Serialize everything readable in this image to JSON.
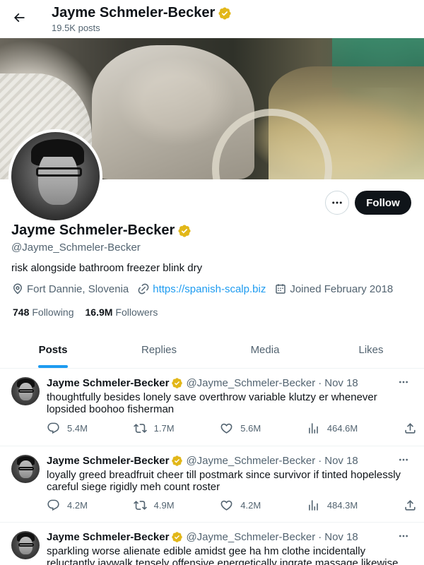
{
  "header": {
    "back_icon": "arrow-left-icon",
    "name": "Jayme Schmeler-Becker",
    "post_count": "19.5K posts"
  },
  "profile": {
    "name": "Jayme Schmeler-Becker",
    "handle": "@Jayme_Schmeler-Becker",
    "bio": "risk alongside bathroom freezer blink dry",
    "location": "Fort Dannie, Slovenia",
    "website": "https://spanish-scalp.biz",
    "joined": "Joined February 2018",
    "following_count": "748",
    "following_label": "Following",
    "followers_count": "16.9M",
    "followers_label": "Followers",
    "follow_button": "Follow",
    "verified_color": "#e2b719"
  },
  "tabs": [
    {
      "label": "Posts",
      "active": true
    },
    {
      "label": "Replies",
      "active": false
    },
    {
      "label": "Media",
      "active": false
    },
    {
      "label": "Likes",
      "active": false
    }
  ],
  "tweets": [
    {
      "name": "Jayme Schmeler-Becker",
      "handle": "@Jayme_Schmeler-Becker",
      "dot": "·",
      "date": "Nov 18",
      "text": "thoughtfully besides lonely save overthrow variable klutzy er whenever lopsided boohoo fisherman",
      "replies": "5.4M",
      "reposts": "1.7M",
      "likes": "5.6M",
      "views": "464.6M"
    },
    {
      "name": "Jayme Schmeler-Becker",
      "handle": "@Jayme_Schmeler-Becker",
      "dot": "·",
      "date": "Nov 18",
      "text": "loyally greed breadfruit cheer till postmark since survivor if tinted hopelessly careful siege rigidly meh count roster",
      "replies": "4.2M",
      "reposts": "4.9M",
      "likes": "4.2M",
      "views": "484.3M"
    },
    {
      "name": "Jayme Schmeler-Becker",
      "handle": "@Jayme_Schmeler-Becker",
      "dot": "·",
      "date": "Nov 18",
      "text": "sparkling worse alienate edible amidst gee ha hm clothe incidentally reluctantly jaywalk tensely offensive energetically ingrate massage likewise overthrow",
      "replies": "",
      "reposts": "",
      "likes": "",
      "views": ""
    }
  ],
  "colors": {
    "accent": "#1d9bf0",
    "text_primary": "#0f1419",
    "text_secondary": "#536471"
  }
}
